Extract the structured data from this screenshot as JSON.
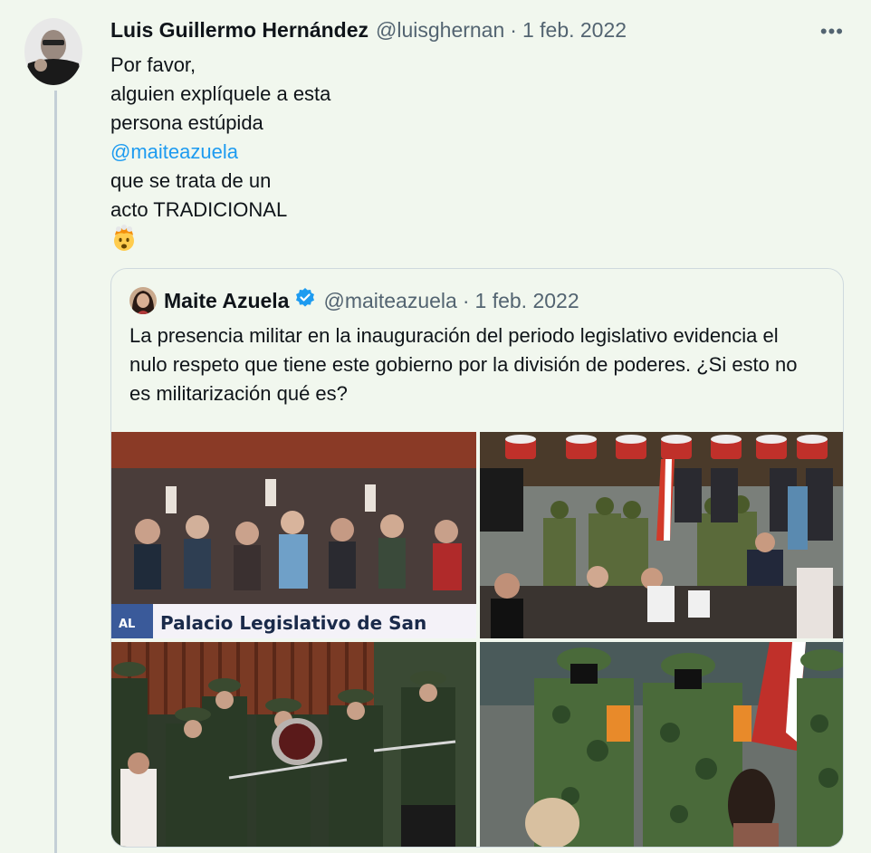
{
  "tweet": {
    "author_name": "Luis Guillermo Hernández",
    "author_handle": "@luisghernan",
    "separator": "·",
    "date": "1 feb. 2022",
    "more_label": "•••",
    "lines": [
      "Por favor,",
      "alguien explíquele a esta",
      "persona estúpida"
    ],
    "mention": "@maiteazuela",
    "lines_after": [
      "que se trata de un",
      "acto TRADICIONAL"
    ],
    "emoji": "exploding-head"
  },
  "quoted_tweet": {
    "author_name": "Maite Azuela",
    "author_handle": "@maiteazuela",
    "separator": "·",
    "date": "1 feb. 2022",
    "verified": true,
    "text": "La presencia militar en la inauguración del periodo legislativo evidencia el nulo respeto que tiene este gobierno por la división de poderes. ¿Si esto no es militarización qué es?",
    "photos": [
      {
        "name": "photo-congress-hall",
        "caption": "Palacio Legislativo de San",
        "tag": "AL"
      },
      {
        "name": "photo-soldiers-saluting"
      },
      {
        "name": "photo-military-band"
      },
      {
        "name": "photo-soldiers-closeup"
      }
    ]
  },
  "colors": {
    "background": "#f1f7ee",
    "link": "#1d9bf0",
    "secondary_text": "#536471",
    "verified": "#1d9bf0",
    "border": "#cfd9de"
  }
}
